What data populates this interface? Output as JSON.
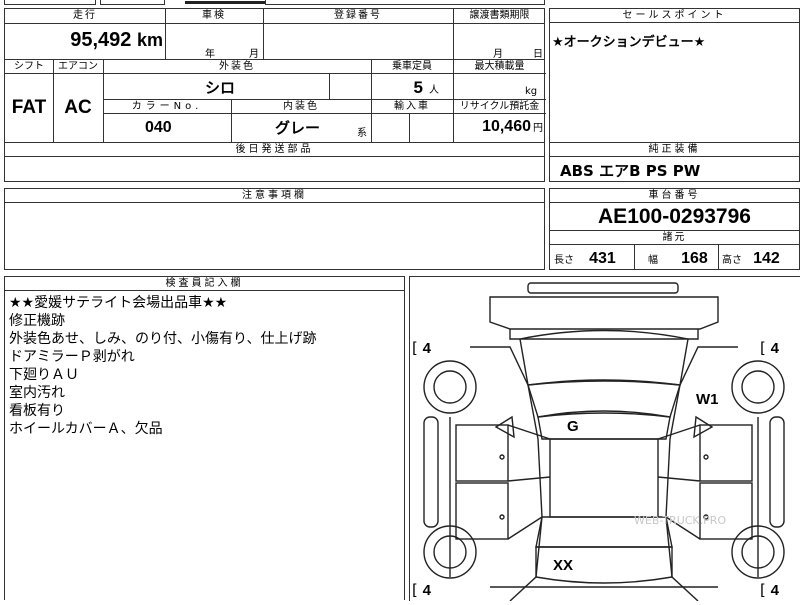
{
  "top_strip": {
    "left_fragment": "",
    "mid_fragment": "…",
    "right_fragment": ""
  },
  "mileage": {
    "header": "走行",
    "value": "95,492",
    "unit": "km"
  },
  "inspection": {
    "header": "車検",
    "month_label": "月",
    "year_label": "年"
  },
  "registration": {
    "header": "登録番号"
  },
  "transfer": {
    "header": "譲渡書類期限",
    "month_label": "月",
    "day_label": "日"
  },
  "sales_point": {
    "header": "セールスポイント",
    "text": "★オークションデビュー★"
  },
  "shift": {
    "header": "シフト",
    "value": "FAT"
  },
  "aircon": {
    "header": "エアコン",
    "value": "AC"
  },
  "exterior_color": {
    "header": "外装色",
    "value": "シロ"
  },
  "capacity": {
    "header": "乗車定員",
    "value": "5",
    "unit": "人"
  },
  "max_load": {
    "header": "最大積載量",
    "unit": "kg"
  },
  "color_no": {
    "header": "カラーNo.",
    "value": "040"
  },
  "interior_color": {
    "header": "内装色",
    "value": "グレー",
    "suffix": "系"
  },
  "import": {
    "header": "輸入車"
  },
  "recycle": {
    "header": "リサイクル預託金",
    "value": "10,460",
    "unit": "円"
  },
  "later_parts": {
    "header": "後日発送部品"
  },
  "genuine_equipment": {
    "header": "純正装備",
    "value": "ABS エアB PS PW"
  },
  "notes": {
    "header": "注意事項欄"
  },
  "chassis": {
    "header": "車台番号",
    "value": "AE100-0293796"
  },
  "specs": {
    "header": "諸元",
    "length_label": "長さ",
    "length": "431",
    "width_label": "幅",
    "width": "168",
    "height_label": "高さ",
    "height": "142"
  },
  "inspector": {
    "header": "検査員記入欄",
    "lines": [
      "★★愛媛サテライト会場出品車★★",
      "修正機跡",
      "外装色あせ、しみ、のり付、小傷有り、仕上げ跡",
      "ドアミラーＰ剥がれ",
      "下廻りＡＵ",
      "室内汚れ",
      "看板有り",
      "ホイールカバーＡ、欠品"
    ]
  },
  "diagram": {
    "tire_fl": "4",
    "tire_fr": "4",
    "tire_rl": "4",
    "tire_rr": "4",
    "mark_w1": "W1",
    "mark_g": "G",
    "mark_xx": "XX",
    "watermark": "WEB-TRUCK.PRO"
  }
}
